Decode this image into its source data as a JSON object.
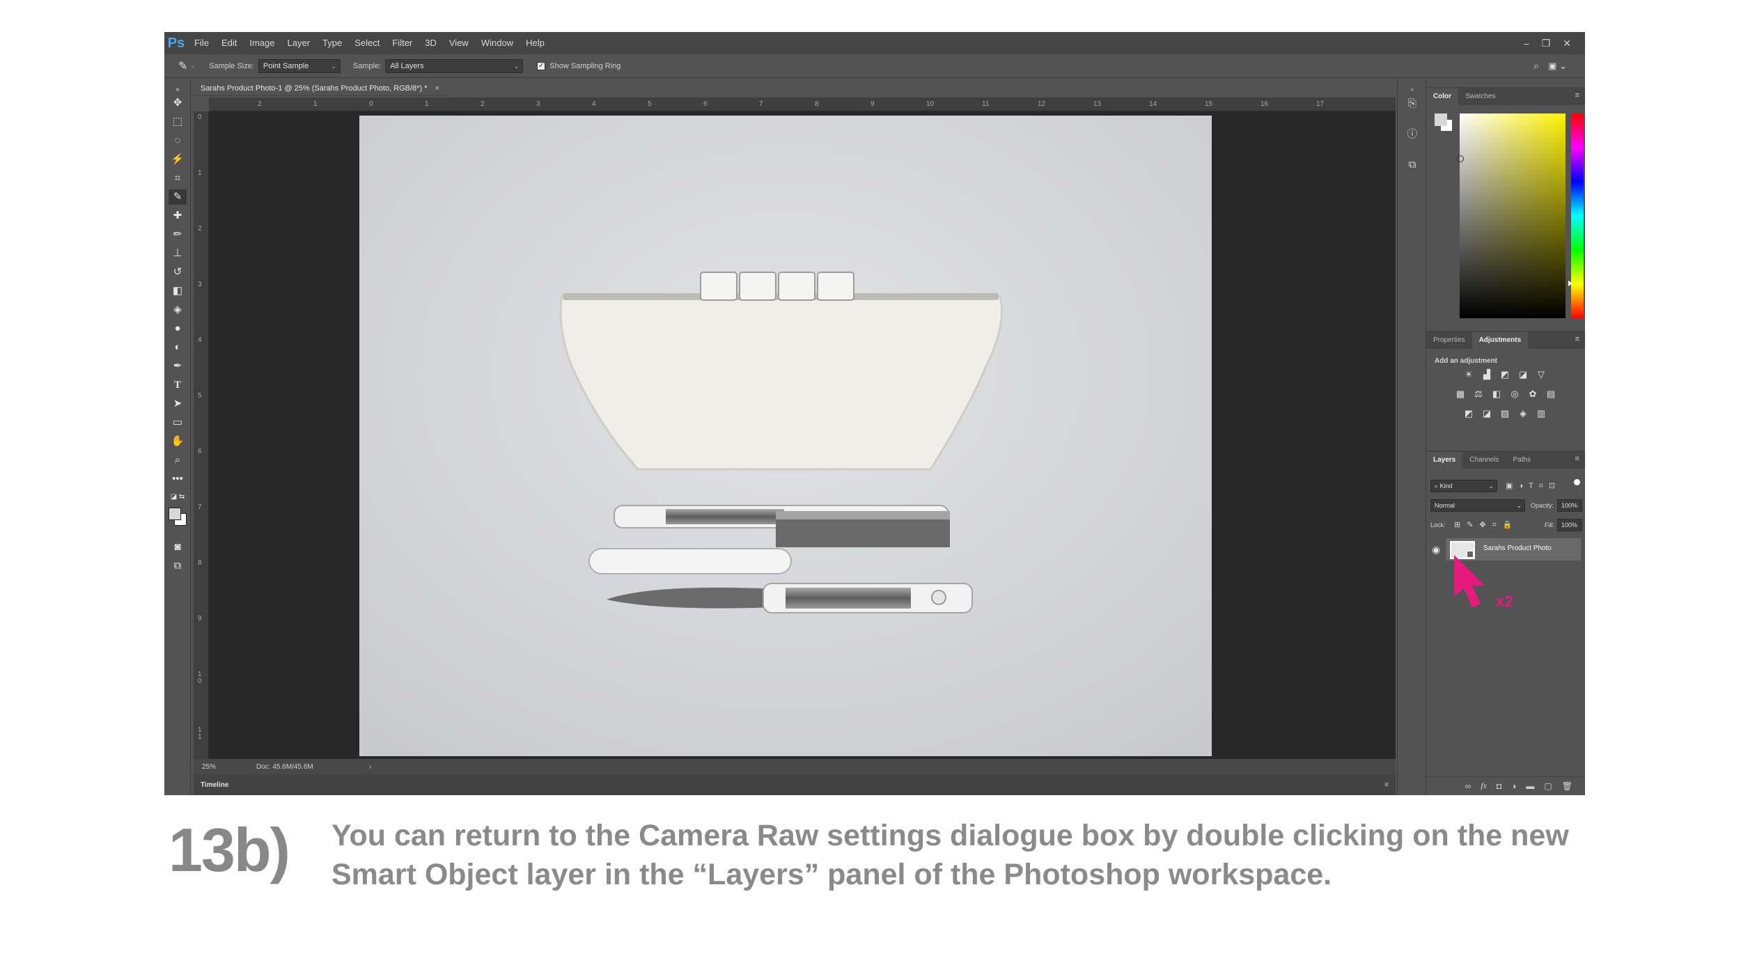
{
  "app": {
    "logo": "Ps"
  },
  "menu": [
    "File",
    "Edit",
    "Image",
    "Layer",
    "Type",
    "Select",
    "Filter",
    "3D",
    "View",
    "Window",
    "Help"
  ],
  "window_controls": [
    "–",
    "❐",
    "✕"
  ],
  "options_bar": {
    "sample_size_label": "Sample Size:",
    "sample_size_value": "Point Sample",
    "sample_label": "Sample:",
    "sample_value": "All Layers",
    "show_sampling_ring": "Show Sampling Ring"
  },
  "document": {
    "tab_title": "Sarahs Product Photo-1 @ 25% (Sarahs Product Photo, RGB/8*) *",
    "ruler_top": [
      "2",
      "1",
      "0",
      "1",
      "2",
      "3",
      "4",
      "5",
      "6",
      "7",
      "8",
      "9",
      "10",
      "11",
      "12",
      "13",
      "14",
      "15",
      "16",
      "17"
    ],
    "ruler_left": [
      "0",
      "1",
      "2",
      "3",
      "4",
      "5",
      "6",
      "7",
      "8",
      "9",
      "1 0",
      "1 1"
    ]
  },
  "status": {
    "zoom": "25%",
    "doc": "Doc: 45.6M/45.6M"
  },
  "timeline_label": "Timeline",
  "color_panel": {
    "tabs": [
      "Color",
      "Swatches"
    ]
  },
  "adjustments_panel": {
    "tabs": [
      "Properties",
      "Adjustments"
    ],
    "heading": "Add an adjustment"
  },
  "layers_panel": {
    "tabs": [
      "Layers",
      "Channels",
      "Paths"
    ],
    "kind": "Kind",
    "blend_mode": "Normal",
    "opacity_label": "Opacity:",
    "opacity_value": "100%",
    "lock_label": "Lock:",
    "fill_label": "Fill:",
    "fill_value": "100%",
    "layer_name": "Sarahs Product Photo"
  },
  "annotation": {
    "label": "x2",
    "color": "#e6197d"
  },
  "caption": {
    "step": "13b)",
    "text": "You can return to the Camera Raw settings dialogue box by double clicking on the new Smart Object layer in the “Layers” panel of the Photoshop workspace."
  }
}
